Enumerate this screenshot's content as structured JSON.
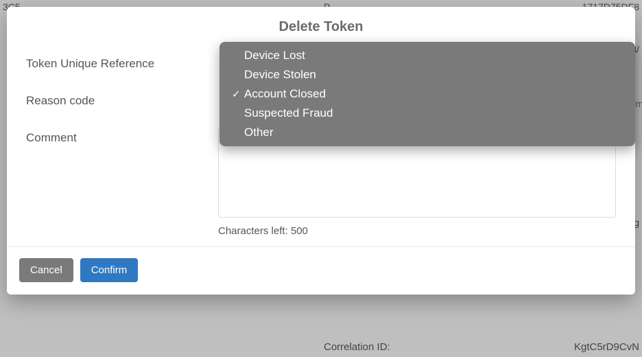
{
  "background": {
    "top_left_fragment": "3C5",
    "top_mid_fragment": "P",
    "top_right_fragment": "1717D75DF8",
    "right_col_3": "3/",
    "right_col_m": "m",
    "right_col_g": "g",
    "correlation_label": "Correlation ID:",
    "correlation_value": "KgtC5rD9CvN"
  },
  "modal": {
    "title": "Delete Token",
    "labels": {
      "token_ref": "Token Unique Reference",
      "reason_code": "Reason code",
      "comment": "Comment"
    },
    "comment_value": "",
    "char_counter_prefix": "Characters left: ",
    "char_counter_value": "500",
    "buttons": {
      "cancel": "Cancel",
      "confirm": "Confirm"
    }
  },
  "dropdown": {
    "selected_index": 2,
    "options": [
      "Device Lost",
      "Device Stolen",
      "Account Closed",
      "Suspected Fraud",
      "Other"
    ]
  }
}
